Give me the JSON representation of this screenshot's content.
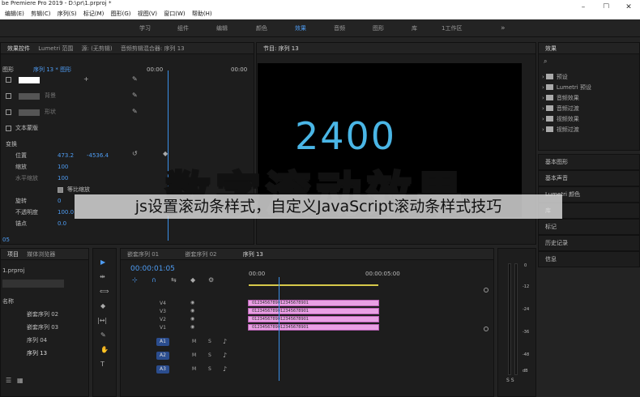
{
  "window": {
    "title": "be Premiere Pro 2019 - D:\\pr\\1.prproj *",
    "controls": [
      "–",
      "☐",
      "✕"
    ]
  },
  "menu": [
    "编辑(E)",
    "剪辑(C)",
    "序列(S)",
    "标记(M)",
    "图形(G)",
    "视图(V)",
    "窗口(W)",
    "帮助(H)"
  ],
  "workspaces": [
    "学习",
    "组件",
    "编辑",
    "颜色",
    "效果",
    "音频",
    "图形",
    "库",
    "1工作区",
    "»"
  ],
  "effect_controls": {
    "tabs": [
      "效果控件",
      "Lumetri 范围",
      "源: (无剪辑)",
      "音频剪辑混合器: 序列 13"
    ],
    "breadcrumb": "图形",
    "sequence": "序列 13 * 图形",
    "ruler": [
      "00:00",
      "00:00"
    ],
    "layer_labels": [
      "背景",
      "形状"
    ],
    "text_mask_label": "文本蒙版",
    "transform_label": "变换",
    "props": [
      {
        "name": "位置",
        "value": "473.2",
        "value2": "-4536.4"
      },
      {
        "name": "缩放",
        "value": "100",
        "value2": ""
      },
      {
        "name": "水平缩放",
        "value": "100",
        "value2": ""
      },
      {
        "name": "等比缩放",
        "value": "",
        "value2": ""
      },
      {
        "name": "旋转",
        "value": "0",
        "value2": ""
      },
      {
        "name": "不透明度",
        "value": "100.0",
        "value2": ""
      },
      {
        "name": "锚点",
        "value": "0.0",
        "value2": ""
      }
    ],
    "timecode": "05"
  },
  "program": {
    "title": "节目: 序列 13",
    "number": "2400"
  },
  "overlay_title": "数字滚动效果",
  "subtitle": "js设置滚动条样式，自定义JavaScript滚动条样式技巧",
  "effects": {
    "title": "效果",
    "items": [
      "预设",
      "Lumetri 预设",
      "音频效果",
      "音频过渡",
      "视频效果",
      "视频过渡"
    ],
    "panels": [
      "基本图形",
      "基本声音",
      "Lumetri 颜色",
      "库",
      "标记",
      "历史记录",
      "信息"
    ]
  },
  "project": {
    "tabs": [
      "项目",
      "媒体浏览器"
    ],
    "file": "1.prproj",
    "col_name": "名称",
    "items": [
      "嵌套序列 02",
      "嵌套序列 03",
      "序列 04",
      "序列 13"
    ]
  },
  "timeline": {
    "tabs": [
      "嵌套序列 01",
      "嵌套序列 02",
      "序列 13"
    ],
    "timecode": "00:00:01:05",
    "ruler": [
      "00:00",
      "00:00:05:00"
    ],
    "video_tracks": [
      "V4",
      "V3",
      "V2",
      "V1"
    ],
    "audio_tracks": [
      "A1",
      "A2",
      "A3"
    ],
    "clip_text": "0123456789012345678901",
    "toggles": [
      "M",
      "S"
    ]
  },
  "meter_labels": [
    "0",
    "-12",
    "-24",
    "-36",
    "-48",
    "dB"
  ],
  "meter_bottom": "S S",
  "tools": [
    "▶",
    "⇹",
    "⟺",
    "◆",
    "|↔|",
    "✎",
    "✋",
    "T"
  ]
}
